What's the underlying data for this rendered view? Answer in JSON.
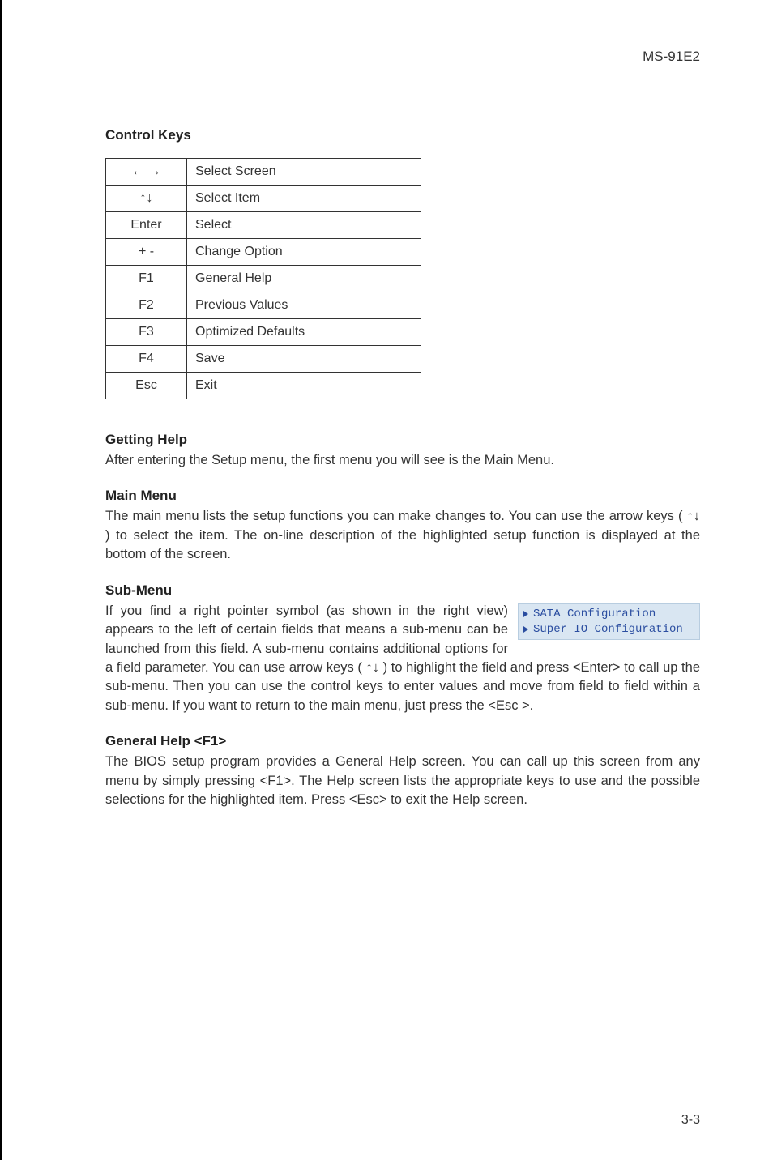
{
  "header": {
    "model": "MS-91E2"
  },
  "control_keys": {
    "title": "Control Keys",
    "rows": [
      {
        "key": "← →",
        "desc": "Select Screen"
      },
      {
        "key": "↑↓",
        "desc": "Select Item"
      },
      {
        "key": "Enter",
        "desc": "Select"
      },
      {
        "key": "+ -",
        "desc": "Change Option"
      },
      {
        "key": "F1",
        "desc": "General Help"
      },
      {
        "key": "F2",
        "desc": "Previous Values"
      },
      {
        "key": "F3",
        "desc": "Optimized Defaults"
      },
      {
        "key": "F4",
        "desc": "Save"
      },
      {
        "key": "Esc",
        "desc": "Exit"
      }
    ]
  },
  "getting_help": {
    "title": "Getting Help",
    "text": "After entering the Setup menu, the first menu you will see is the Main Menu."
  },
  "main_menu": {
    "title": "Main Menu",
    "text": "The main menu lists the setup functions you can make changes to. You can use the arrow keys ( ↑↓ ) to select the item. The on-line description of the highlighted setup function is displayed at the bottom of the screen."
  },
  "sub_menu": {
    "title": "Sub-Menu",
    "text1": "If you find a right pointer symbol (as shown in the right view) appears to the left of certain fields that means a sub-menu can be launched from this field. A sub-menu contains additional options for a field parameter. You can use arrow keys  ( ↑↓ ) to highlight the field and press <Enter> to call up the sub-menu. Then you can use the control keys to enter values and  move from field to field within a sub-menu. If you want to return to the main menu, just press the <Esc >.",
    "inset": {
      "line1": "SATA Configuration",
      "line2": "Super IO Configuration"
    }
  },
  "general_help": {
    "title": "General Help <F1>",
    "text": "The BIOS setup program provides a General  Help screen. You can call up this screen from any menu by simply pressing <F1>. The Help screen lists the appropriate keys to use and the possible selections for the highlighted item. Press <Esc> to exit the Help screen."
  },
  "footer": {
    "page": "3-3"
  }
}
